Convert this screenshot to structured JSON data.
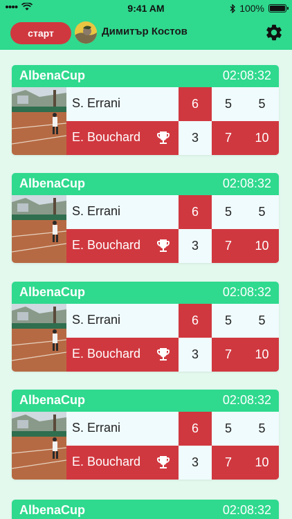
{
  "status_bar": {
    "time": "9:41 AM",
    "battery": "100%"
  },
  "header": {
    "start_label": "старт",
    "user_name": "Димитър Костов"
  },
  "matches": [
    {
      "tournament": "AlbenaCup",
      "time": "02:08:32",
      "player1": "S. Errani",
      "player2": "E. Bouchard",
      "p1_sets": [
        "6",
        "5",
        "5"
      ],
      "p2_sets": [
        "3",
        "7",
        "10"
      ]
    },
    {
      "tournament": "AlbenaCup",
      "time": "02:08:32",
      "player1": "S. Errani",
      "player2": "E. Bouchard",
      "p1_sets": [
        "6",
        "5",
        "5"
      ],
      "p2_sets": [
        "3",
        "7",
        "10"
      ]
    },
    {
      "tournament": "AlbenaCup",
      "time": "02:08:32",
      "player1": "S. Errani",
      "player2": "E. Bouchard",
      "p1_sets": [
        "6",
        "5",
        "5"
      ],
      "p2_sets": [
        "3",
        "7",
        "10"
      ]
    },
    {
      "tournament": "AlbenaCup",
      "time": "02:08:32",
      "player1": "S. Errani",
      "player2": "E. Bouchard",
      "p1_sets": [
        "6",
        "5",
        "5"
      ],
      "p2_sets": [
        "3",
        "7",
        "10"
      ]
    },
    {
      "tournament": "AlbenaCup",
      "time": "02:08:32"
    }
  ],
  "icons": {
    "settings": "gear-icon",
    "winner": "trophy-icon"
  },
  "colors": {
    "accent_green": "#2fd98e",
    "accent_red": "#d0383f",
    "background": "#e3f9ee"
  }
}
